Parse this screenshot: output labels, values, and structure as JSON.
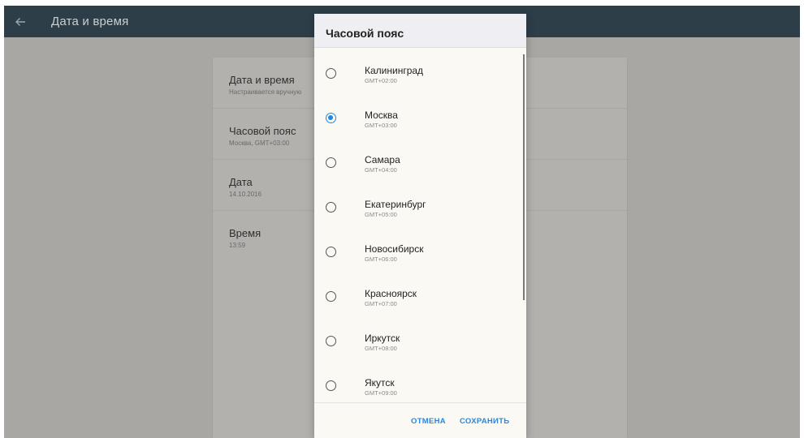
{
  "appbar": {
    "title": "Дата и время",
    "back_icon": "arrow-left-icon"
  },
  "settings": [
    {
      "title": "Дата и время",
      "subtitle": "Настраивается вручную"
    },
    {
      "title": "Часовой пояс",
      "subtitle": "Москва, GMT+03:00"
    },
    {
      "title": "Дата",
      "subtitle": "14.10.2016"
    },
    {
      "title": "Время",
      "subtitle": "13:59"
    }
  ],
  "dialog": {
    "title": "Часовой пояс",
    "zones": [
      {
        "name": "Калининград",
        "offset": "GMT+02:00",
        "selected": false
      },
      {
        "name": "Москва",
        "offset": "GMT+03:00",
        "selected": true
      },
      {
        "name": "Самара",
        "offset": "GMT+04:00",
        "selected": false
      },
      {
        "name": "Екатеринбург",
        "offset": "GMT+05:00",
        "selected": false
      },
      {
        "name": "Новосибирск",
        "offset": "GMT+06:00",
        "selected": false
      },
      {
        "name": "Красноярск",
        "offset": "GMT+07:00",
        "selected": false
      },
      {
        "name": "Иркутск",
        "offset": "GMT+08:00",
        "selected": false
      },
      {
        "name": "Якутск",
        "offset": "GMT+09:00",
        "selected": false
      }
    ],
    "cancel_label": "ОТМЕНА",
    "save_label": "СОХРАНИТЬ"
  },
  "colors": {
    "accent": "#1e88e5",
    "appbar": "#2d3e49"
  }
}
